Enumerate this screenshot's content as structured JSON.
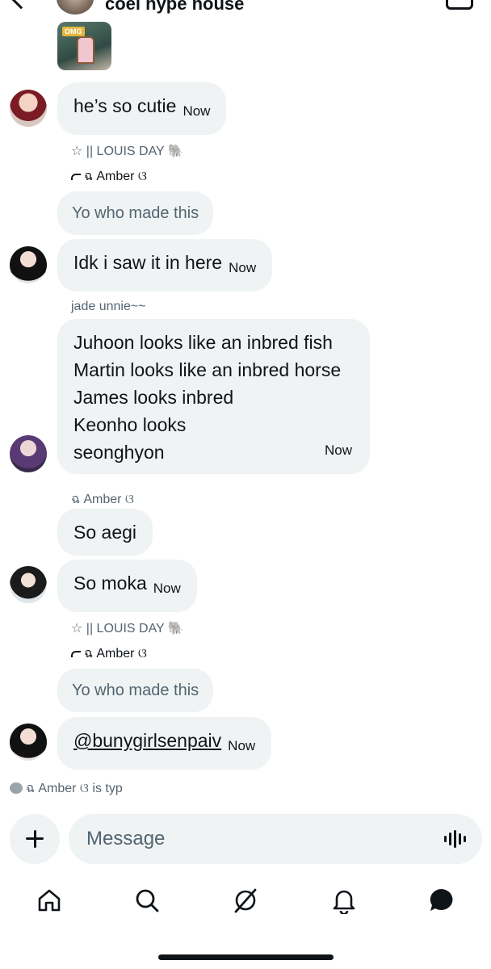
{
  "header": {
    "title": "coel hype house"
  },
  "thumbnail": {
    "tag": "OMG"
  },
  "messages": {
    "m1": {
      "text": "he’s so cutie",
      "time": "Now"
    },
    "m2": {
      "sender": "☆ || LOUIS DAY 🐘",
      "reply_to": "ฉ Amber ଓ",
      "quoted": "Yo who made this"
    },
    "m3": {
      "text": "Idk i saw it in here",
      "time": "Now"
    },
    "m4": {
      "sender": "jade unnie~~",
      "lines": [
        "Juhoon looks like an inbred fish",
        "Martin looks like an inbred horse",
        "James looks inbred",
        "Keonho looks",
        "seonghyon"
      ],
      "time": "Now"
    },
    "m5": {
      "sender": "ฉ Amber ଓ",
      "text": "So aegi"
    },
    "m6": {
      "text": "So moka",
      "time": "Now"
    },
    "m7": {
      "sender": "☆ || LOUIS DAY 🐘",
      "reply_to": "ฉ Amber ଓ",
      "quoted": "Yo who made this"
    },
    "m8": {
      "text": "@bunygirlsenpaiv",
      "time": "Now"
    }
  },
  "typing": {
    "text": "ฉ Amber ଓ is typ"
  },
  "composer": {
    "placeholder": "Message"
  },
  "tabs": [
    "home-icon",
    "search-icon",
    "grok-icon",
    "notifications-icon",
    "messages-icon"
  ]
}
